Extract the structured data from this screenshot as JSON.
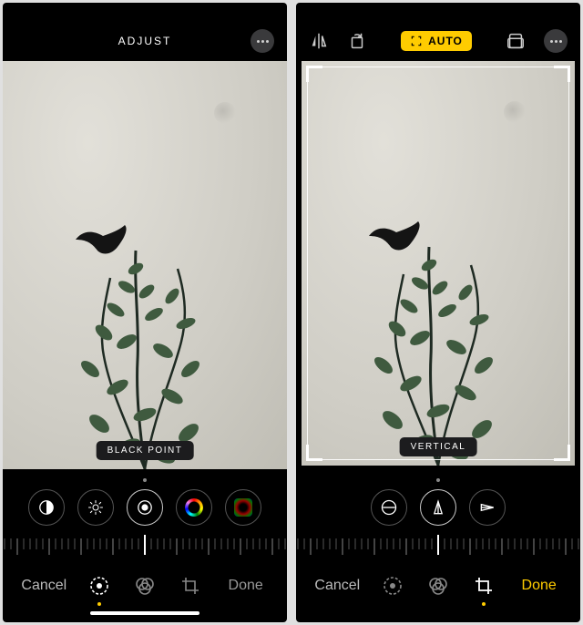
{
  "left": {
    "header_title": "ADJUST",
    "tool_label": "BLACK POINT",
    "tools": [
      {
        "name": "contrast"
      },
      {
        "name": "brightness"
      },
      {
        "name": "black-point",
        "selected": true
      },
      {
        "name": "saturation"
      },
      {
        "name": "vignette"
      }
    ],
    "bottom": {
      "cancel": "Cancel",
      "done": "Done",
      "active_mode": "adjust"
    }
  },
  "right": {
    "auto_label": "AUTO",
    "tool_label": "VERTICAL",
    "tools": [
      {
        "name": "straighten"
      },
      {
        "name": "vertical",
        "selected": true
      },
      {
        "name": "horizontal"
      }
    ],
    "bottom": {
      "cancel": "Cancel",
      "done": "Done",
      "active_mode": "crop"
    }
  },
  "colors": {
    "accent": "#ffcc00",
    "bg": "#000000"
  }
}
